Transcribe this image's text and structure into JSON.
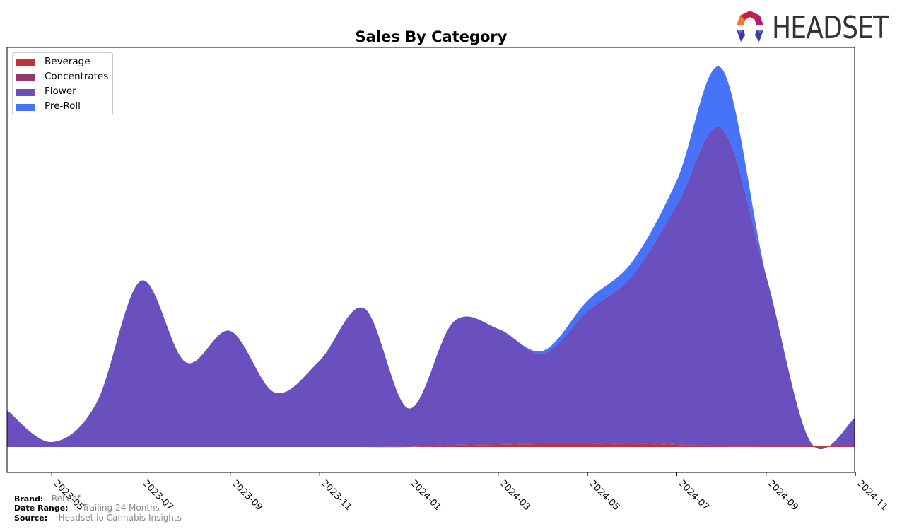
{
  "chart_data": {
    "type": "area",
    "stacked": true,
    "title": "Sales By Category",
    "xlabel": "",
    "ylabel": "",
    "x": [
      "2023-04",
      "2023-05",
      "2023-06",
      "2023-07",
      "2023-08",
      "2023-09",
      "2023-10",
      "2023-11",
      "2023-12",
      "2024-01",
      "2024-02",
      "2024-03",
      "2024-04",
      "2024-05",
      "2024-06",
      "2024-07",
      "2024-08",
      "2024-09",
      "2024-10",
      "2024-11"
    ],
    "x_tick_labels": [
      "2023-05",
      "2023-07",
      "2023-09",
      "2023-11",
      "2024-01",
      "2024-03",
      "2024-05",
      "2024-07",
      "2024-09",
      "2024-11"
    ],
    "y_ticks_shown": false,
    "grid": false,
    "legend_position": "top-left",
    "series": [
      {
        "name": "Beverage",
        "color": "#c0333a",
        "values": [
          0,
          0,
          0,
          0,
          0,
          0,
          0,
          0,
          0,
          0,
          2,
          3,
          4,
          4,
          5,
          3,
          1,
          1,
          1,
          1
        ]
      },
      {
        "name": "Concentrates",
        "color": "#923a6e",
        "values": [
          0,
          0,
          0,
          0,
          0,
          0,
          0,
          0,
          0,
          0.5,
          1,
          1,
          1,
          1,
          1,
          1,
          0.5,
          0.5,
          0.5,
          1
        ]
      },
      {
        "name": "Flower",
        "color": "#6a4fbf",
        "values": [
          52,
          7,
          62,
          235,
          120,
          164,
          77,
          122,
          196,
          54,
          174,
          163,
          127,
          187,
          236,
          338,
          449,
          240,
          5,
          40
        ]
      },
      {
        "name": "Pre-Roll",
        "color": "#4673f7",
        "values": [
          0,
          0,
          0,
          0,
          0,
          0,
          0,
          0,
          0,
          0,
          0,
          0,
          4,
          15,
          20,
          35,
          85,
          0,
          0,
          0
        ]
      }
    ]
  },
  "footer": {
    "brand_label": "Brand:",
    "brand_value": "ReLeaf",
    "date_range_label": "Date Range:",
    "date_range_value": "Trailing 24 Months",
    "source_label": "Source:",
    "source_value": "Headset.io Cannabis Insights"
  },
  "logo": {
    "text": "HEADSET"
  }
}
